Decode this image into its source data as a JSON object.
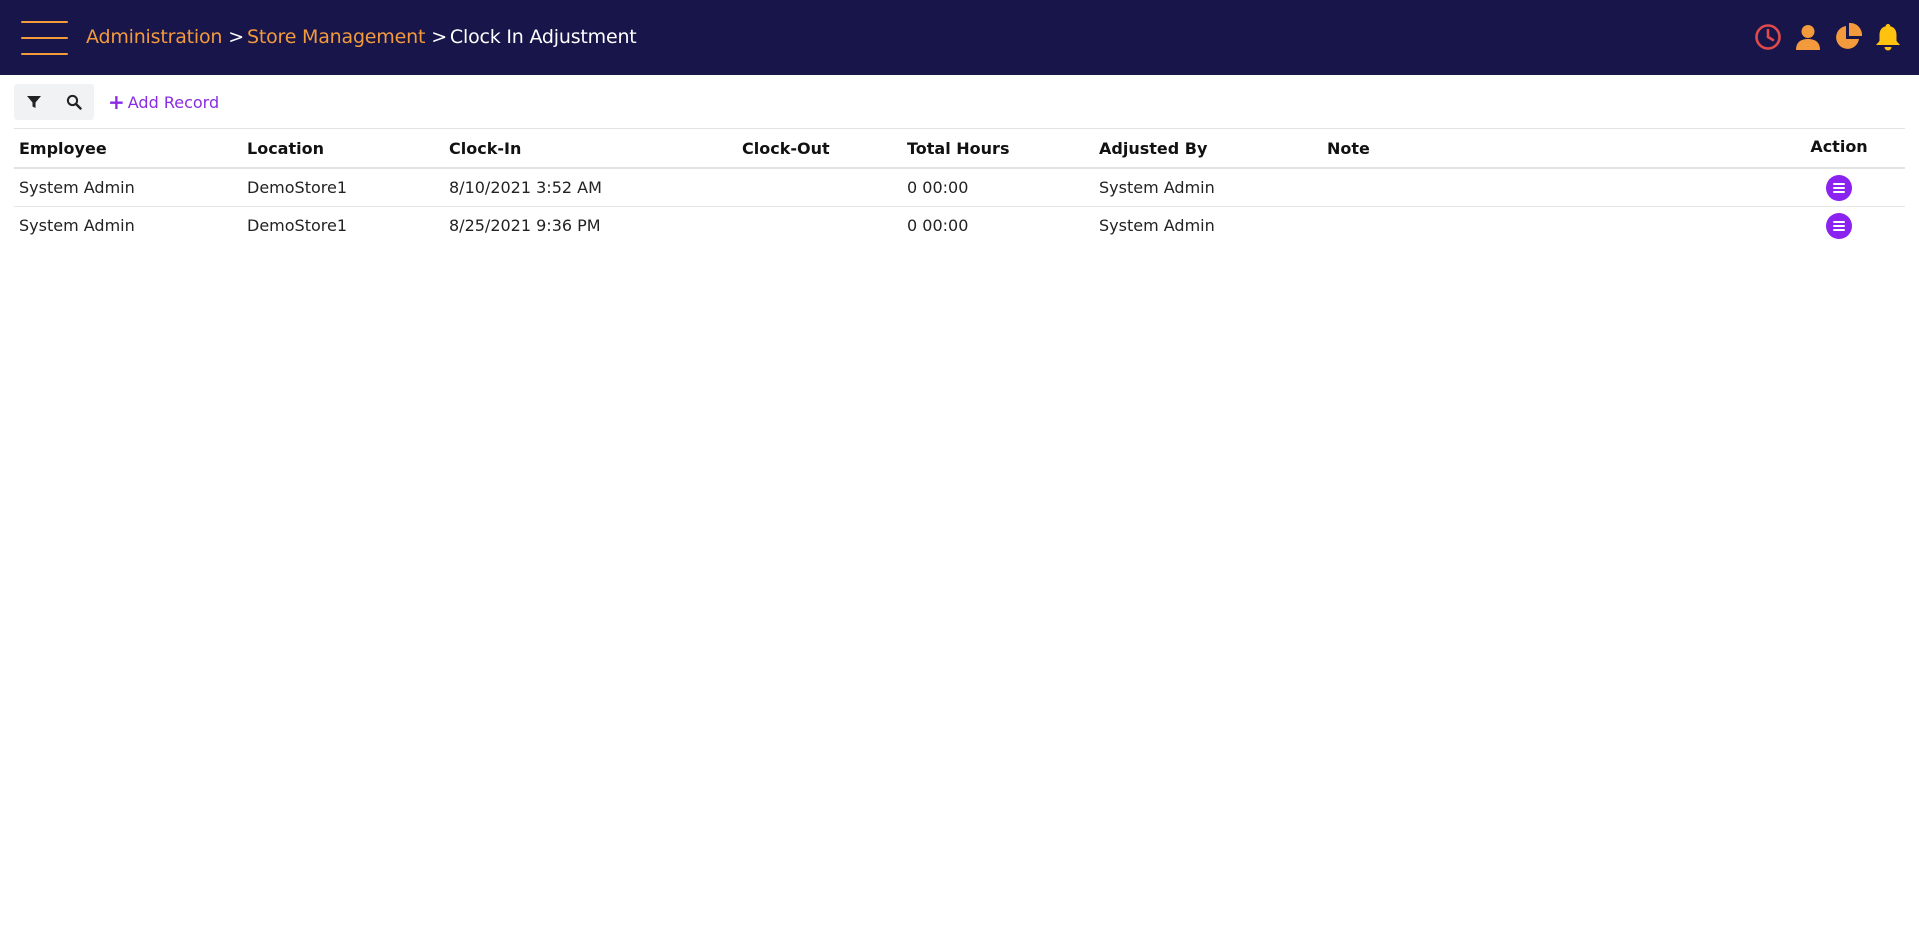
{
  "colors": {
    "topbar_bg": "#17154a",
    "accent_orange": "#f39a3d",
    "accent_purple": "#8a2be2",
    "clock_red": "#e04a4a"
  },
  "breadcrumb": {
    "items": [
      "Administration",
      "Store Management"
    ],
    "separator": ">",
    "current": "Clock In Adjustment"
  },
  "top_icons": [
    "clock-icon",
    "user-icon",
    "pie-chart-icon",
    "bell-icon"
  ],
  "toolbar": {
    "filter_icon": "filter-icon",
    "search_icon": "search-icon",
    "add_label": "Add Record"
  },
  "table": {
    "columns": [
      "Employee",
      "Location",
      "Clock-In",
      "Clock-Out",
      "Total Hours",
      "Adjusted By",
      "Note",
      "Action"
    ],
    "rows": [
      {
        "employee": "System Admin",
        "location": "DemoStore1",
        "clock_in": "8/10/2021 3:52 AM",
        "clock_out": "",
        "total_hours": "0 00:00",
        "adjusted_by": "System Admin",
        "note": ""
      },
      {
        "employee": "System Admin",
        "location": "DemoStore1",
        "clock_in": "8/25/2021 9:36 PM",
        "clock_out": "",
        "total_hours": "0 00:00",
        "adjusted_by": "System Admin",
        "note": ""
      }
    ]
  }
}
